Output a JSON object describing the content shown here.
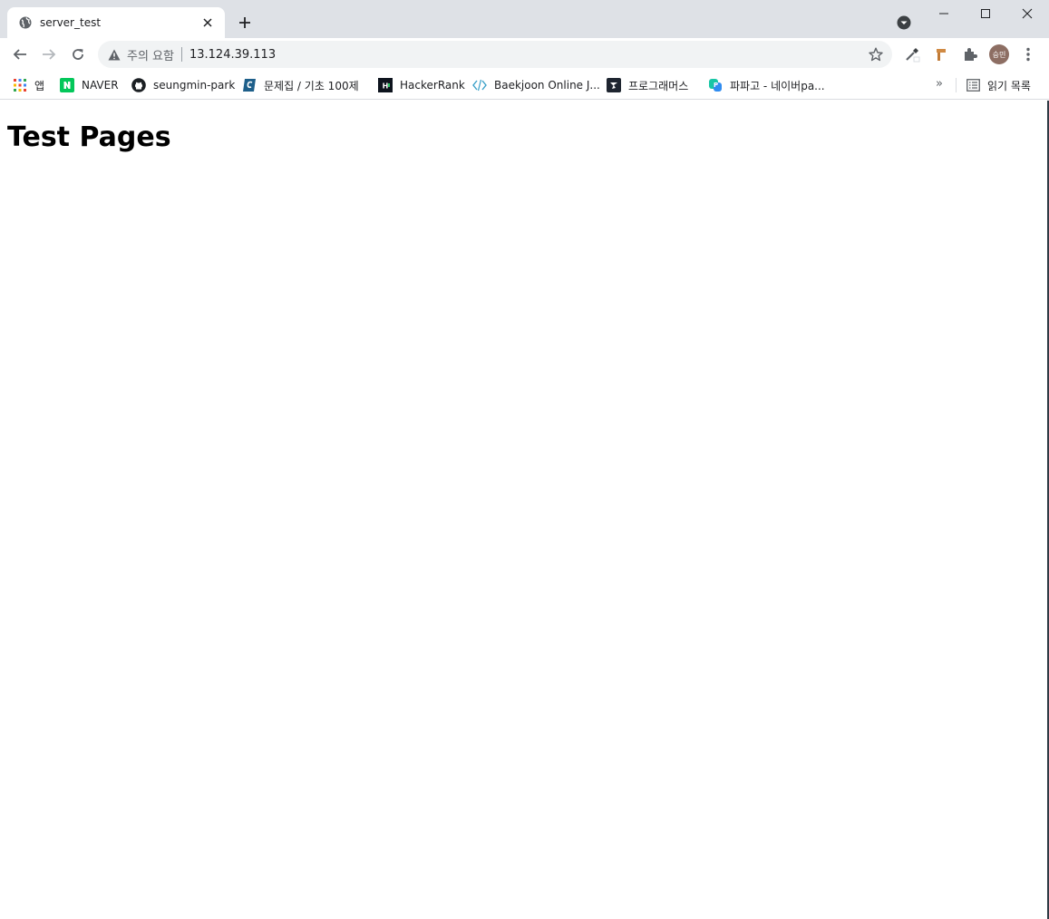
{
  "tab": {
    "title": "server_test"
  },
  "omnibox": {
    "security_label": "주의 요함",
    "url": "13.124.39.113"
  },
  "profile": {
    "avatar_text": "승민",
    "avatar_color": "#8d6e63"
  },
  "bookmarks": [
    {
      "label": "앱",
      "icon": "apps-grid-icon"
    },
    {
      "label": "NAVER",
      "icon": "naver-icon"
    },
    {
      "label": "seungmin-park",
      "icon": "github-icon"
    },
    {
      "label": "문제집 / 기초 100제",
      "icon": "codeup-icon"
    },
    {
      "label": "HackerRank",
      "icon": "hackerrank-icon"
    },
    {
      "label": "Baekjoon Online J...",
      "icon": "baekjoon-icon"
    },
    {
      "label": "프로그래머스",
      "icon": "programmers-icon"
    },
    {
      "label": "파파고 - 네이버pa...",
      "icon": "papago-icon"
    }
  ],
  "bookmarks_more": "»",
  "reading_list": {
    "label": "읽기 목록",
    "icon": "reading-list-icon"
  },
  "page": {
    "heading": "Test Pages"
  }
}
